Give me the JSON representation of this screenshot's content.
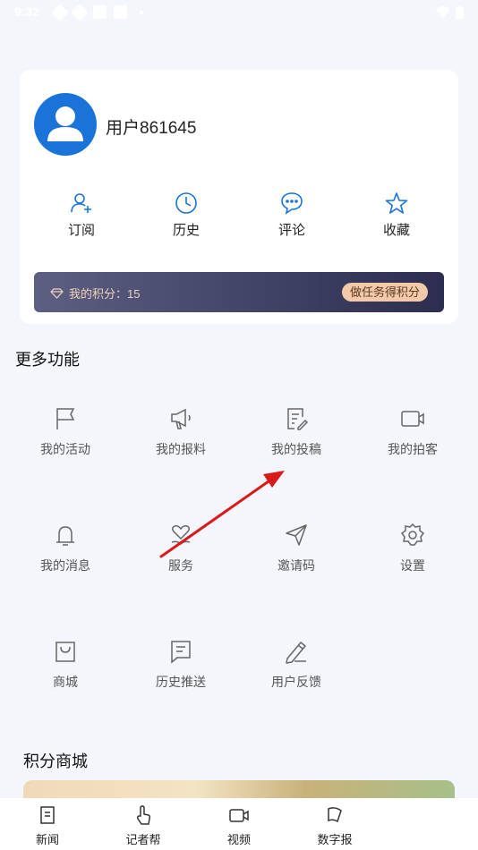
{
  "status_bar": {
    "time": "9:32"
  },
  "profile": {
    "username": "用户861645"
  },
  "quick_actions": [
    {
      "label": "订阅",
      "icon": "user-add-icon"
    },
    {
      "label": "历史",
      "icon": "clock-icon"
    },
    {
      "label": "评论",
      "icon": "comment-icon"
    },
    {
      "label": "收藏",
      "icon": "star-icon"
    }
  ],
  "points": {
    "label": "我的积分：15",
    "task_button": "做任务得积分"
  },
  "more_section": {
    "title": "更多功能",
    "items": [
      {
        "label": "我的活动",
        "icon": "flag-icon"
      },
      {
        "label": "我的报料",
        "icon": "megaphone-icon"
      },
      {
        "label": "我的投稿",
        "icon": "document-edit-icon"
      },
      {
        "label": "我的拍客",
        "icon": "video-camera-icon"
      },
      {
        "label": "我的消息",
        "icon": "bell-icon"
      },
      {
        "label": "服务",
        "icon": "heart-hand-icon"
      },
      {
        "label": "邀请码",
        "icon": "send-icon"
      },
      {
        "label": "设置",
        "icon": "gear-icon"
      },
      {
        "label": "商城",
        "icon": "shopping-bag-icon"
      },
      {
        "label": "历史推送",
        "icon": "message-list-icon"
      },
      {
        "label": "用户反馈",
        "icon": "pencil-icon"
      }
    ]
  },
  "mall_section": {
    "title": "积分商城"
  },
  "tab_bar": [
    {
      "label": "新闻",
      "icon": "news-icon"
    },
    {
      "label": "记者帮",
      "icon": "hand-pointer-icon"
    },
    {
      "label": "视频",
      "icon": "video-icon"
    },
    {
      "label": "数字报",
      "icon": "paper-icon"
    }
  ],
  "colors": {
    "primary": "#1a73d8",
    "points_bar": "#3a3b5e",
    "task_button": "#f3c9a8"
  }
}
